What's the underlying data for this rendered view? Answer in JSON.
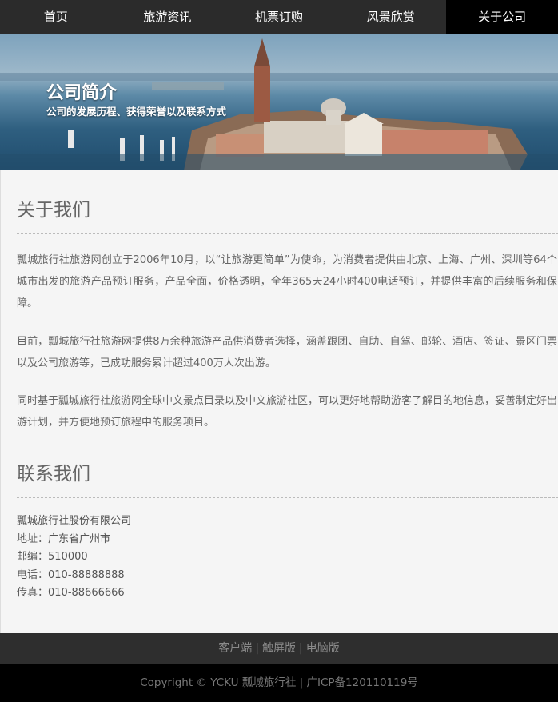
{
  "nav": {
    "items": [
      {
        "label": "首页"
      },
      {
        "label": "旅游资讯"
      },
      {
        "label": "机票订购"
      },
      {
        "label": "风景欣赏"
      },
      {
        "label": "关于公司"
      }
    ],
    "active_index": 4
  },
  "banner": {
    "title": "公司简介",
    "subtitle": "公司的发展历程、获得荣誉以及联系方式"
  },
  "about": {
    "heading": "关于我们",
    "paragraphs": [
      "瓢城旅行社旅游网创立于2006年10月，以“让旅游更简单”为使命，为消费者提供由北京、上海、广州、深圳等64个城市出发的旅游产品预订服务，产品全面，价格透明，全年365天24小时400电话预订，并提供丰富的后续服务和保障。",
      "目前，瓢城旅行社旅游网提供8万余种旅游产品供消费者选择，涵盖跟团、自助、自驾、邮轮、酒店、签证、景区门票以及公司旅游等，已成功服务累计超过400万人次出游。",
      "同时基于瓢城旅行社旅游网全球中文景点目录以及中文旅游社区，可以更好地帮助游客了解目的地信息，妥善制定好出游计划，并方便地预订旅程中的服务项目。"
    ]
  },
  "contact": {
    "heading": "联系我们",
    "lines": [
      "瓢城旅行社股份有限公司",
      "地址：广东省广州市",
      "邮编：510000",
      "电话：010-88888888",
      "传真：010-88666666"
    ]
  },
  "footer": {
    "links": [
      "客户端",
      "触屏版",
      "电脑版"
    ],
    "separator": "|",
    "copyright": "Copyright © YCKU 瓢城旅行社 | 广ICP备120110119号"
  },
  "colors": {
    "nav_bg": "#2b2b2b",
    "nav_active_bg": "#000000",
    "page_bg": "#f5f5f5",
    "footer_links_bg": "#2e2e2e",
    "footer_copy_bg": "#000000"
  }
}
